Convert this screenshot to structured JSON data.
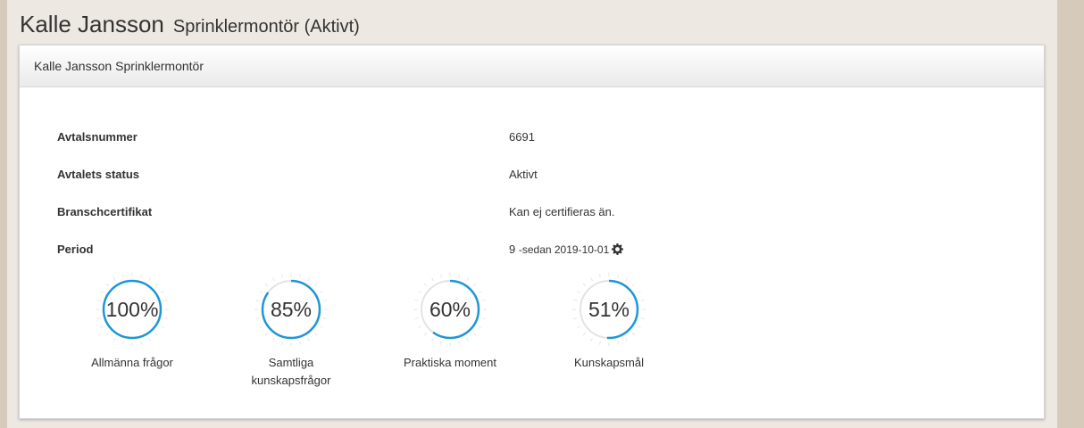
{
  "header": {
    "name": "Kalle Jansson",
    "role": "Sprinklermontör (Aktivt)"
  },
  "panel": {
    "heading_name": "Kalle Jansson",
    "heading_role": "Sprinklermontör"
  },
  "info": {
    "avtalsnummer_label": "Avtalsnummer",
    "avtalsnummer_value": "6691",
    "status_label": "Avtalets status",
    "status_value": "Aktivt",
    "cert_label": "Branschcertifikat",
    "cert_value": "Kan ej certifieras än.",
    "period_label": "Period",
    "period_number": "9",
    "period_text": "-sedan 2019-10-01",
    "period_icon": "gear-icon"
  },
  "gauges": [
    {
      "text": "100%",
      "percent": 100,
      "label": "Allmänna frågor"
    },
    {
      "text": "85%",
      "percent": 85,
      "label": "Samtliga kunskapsfrågor"
    },
    {
      "text": "60%",
      "percent": 60,
      "label": "Praktiska moment"
    },
    {
      "text": "51%",
      "percent": 51,
      "label": "Kunskapsmål"
    }
  ],
  "colors": {
    "accent": "#1f96d6",
    "track": "#e4e4e4",
    "background": "#d6cbbb"
  }
}
